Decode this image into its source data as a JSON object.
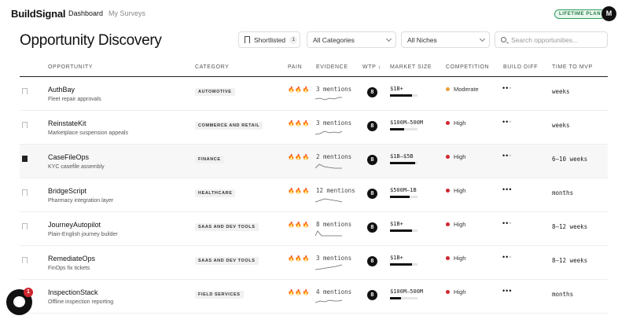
{
  "nav": {
    "brand": "BuildSignal",
    "dashboard": "Dashboard",
    "surveys": "My Surveys",
    "plan": "LIFETIME PLAN",
    "avatar_initial": "M"
  },
  "header": {
    "title": "Opportunity Discovery",
    "shortlisted_label": "Shortlisted",
    "shortlisted_count": "1",
    "category_select": "All Categories",
    "niche_select": "All Niches",
    "search_placeholder": "Search opportunities..."
  },
  "columns": [
    "OPPORTUNITY",
    "CATEGORY",
    "PAIN",
    "EVIDENCE",
    "WTP ↓",
    "MARKET SIZE",
    "COMPETITION",
    "BUILD DIFF",
    "TIME TO MVP"
  ],
  "colors": {
    "high": "#d0262f",
    "moderate": "#e8a13a",
    "flame": "#e06a1b"
  },
  "rows": [
    {
      "name": "AuthBay",
      "desc": "Fleet repair approvals",
      "category": "AUTOMOTIVE",
      "pain": 2,
      "evidence": "3 mentions",
      "wtp": "8",
      "market": "$1B+",
      "market_level": 0.8,
      "competition": "Moderate",
      "comp_level": "moderate",
      "build_diff": 2,
      "ttm": "weeks",
      "shortlisted": false
    },
    {
      "name": "ReinstateKit",
      "desc": "Marketplace suspension appeals",
      "category": "COMMERCE AND RETAIL",
      "pain": 3,
      "evidence": "3 mentions",
      "wtp": "8",
      "market": "$100M–500M",
      "market_level": 0.5,
      "competition": "High",
      "comp_level": "high",
      "build_diff": 2,
      "ttm": "weeks",
      "shortlisted": false
    },
    {
      "name": "CaseFileOps",
      "desc": "KYC casefile assembly",
      "category": "FINANCE",
      "pain": 2,
      "evidence": "2 mentions",
      "wtp": "8",
      "market": "$1B–$5B",
      "market_level": 0.9,
      "competition": "High",
      "comp_level": "high",
      "build_diff": 2,
      "ttm": "6–10 weeks",
      "shortlisted": true
    },
    {
      "name": "BridgeScript",
      "desc": "Pharmacy integration layer",
      "category": "HEALTHCARE",
      "pain": 2,
      "evidence": "12 mentions",
      "wtp": "8",
      "market": "$500M–1B",
      "market_level": 0.7,
      "competition": "High",
      "comp_level": "high",
      "build_diff": 3,
      "ttm": "months",
      "shortlisted": false
    },
    {
      "name": "JourneyAutopilot",
      "desc": "Plain-English journey builder",
      "category": "SAAS AND DEV TOOLS",
      "pain": 2,
      "evidence": "8 mentions",
      "wtp": "8",
      "market": "$1B+",
      "market_level": 0.8,
      "competition": "High",
      "comp_level": "high",
      "build_diff": 2,
      "ttm": "8–12 weeks",
      "shortlisted": false
    },
    {
      "name": "RemediateOps",
      "desc": "FinOps fix tickets",
      "category": "SAAS AND DEV TOOLS",
      "pain": 2,
      "evidence": "3 mentions",
      "wtp": "8",
      "market": "$1B+",
      "market_level": 0.8,
      "competition": "High",
      "comp_level": "high",
      "build_diff": 2,
      "ttm": "8–12 weeks",
      "shortlisted": false
    },
    {
      "name": "InspectionStack",
      "desc": "Offline inspection reporting",
      "category": "FIELD SERVICES",
      "pain": 2,
      "evidence": "4 mentions",
      "wtp": "8",
      "market": "$100M–500M",
      "market_level": 0.4,
      "competition": "High",
      "comp_level": "high",
      "build_diff": 3,
      "ttm": "months",
      "shortlisted": false
    }
  ],
  "chat": {
    "unread": "1"
  }
}
